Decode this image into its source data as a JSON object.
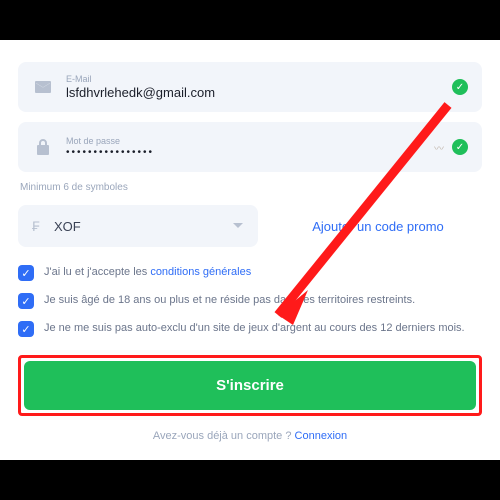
{
  "email": {
    "label": "E-Mail",
    "value": "lsfdhvrlehedk@gmail.com",
    "valid": true
  },
  "password": {
    "label": "Mot de passe",
    "value": "••••••••••••••••",
    "valid": true
  },
  "hint": "Minimum 6 de symboles",
  "currency": {
    "symbol": "₣",
    "code": "XOF"
  },
  "promo": "Ajouter un code promo",
  "checks": {
    "terms_pre": "J'ai lu et j'accepte les ",
    "terms_link": "conditions générales",
    "age": "Je suis âgé de 18 ans ou plus et ne réside pas dans les territoires restreints.",
    "selfexcl": "Je ne me suis pas auto-exclu d'un site de jeux d'argent au cours des 12 derniers mois."
  },
  "signup": "S'inscrire",
  "footer": {
    "text": "Avez-vous déjà un compte ? ",
    "link": "Connexion"
  }
}
